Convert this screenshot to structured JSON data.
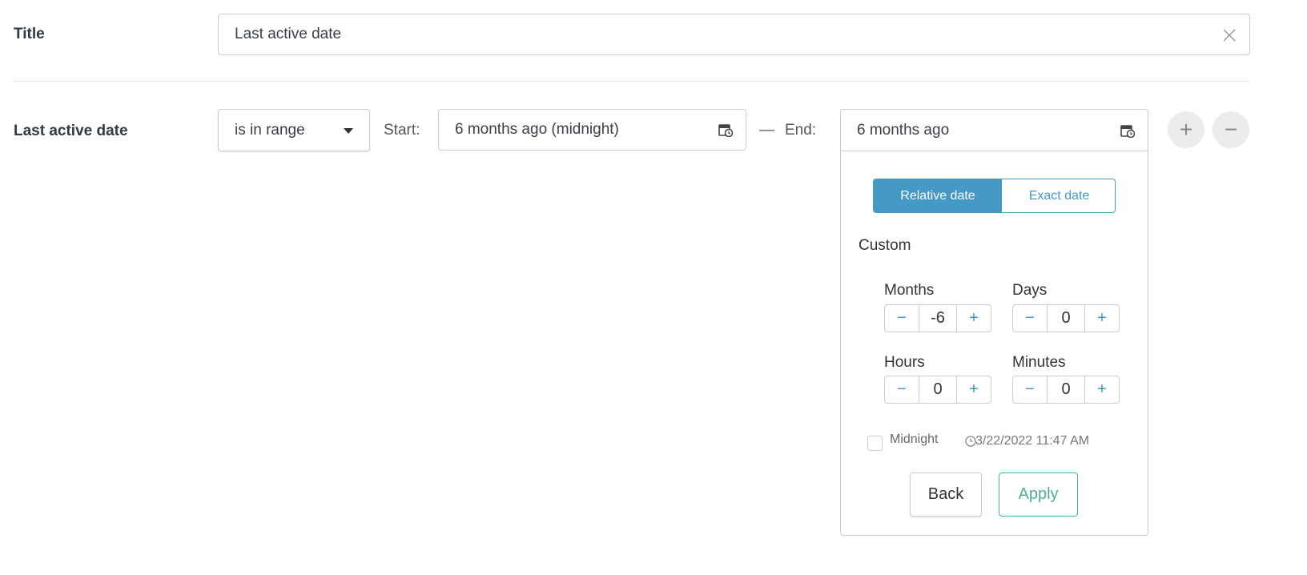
{
  "title_row": {
    "label": "Title",
    "value": "Last active date"
  },
  "filter_row": {
    "label": "Last active date",
    "operator": "is in range",
    "start_label": "Start:",
    "start_value": "6 months ago (midnight)",
    "separator": "—",
    "end_label": "End:",
    "end_value": "6 months ago"
  },
  "popover": {
    "tabs": [
      {
        "label": "Relative date",
        "active": true
      },
      {
        "label": "Exact date",
        "active": false
      }
    ],
    "section": "Custom",
    "steppers": [
      {
        "label": "Months",
        "value": "-6"
      },
      {
        "label": "Days",
        "value": "0"
      },
      {
        "label": "Hours",
        "value": "0"
      },
      {
        "label": "Minutes",
        "value": "0"
      }
    ],
    "decrement": "−",
    "increment": "+",
    "midnight_label": "Midnight",
    "midnight_checked": false,
    "resolved_date": "3/22/2022 11:47 AM",
    "back": "Back",
    "apply": "Apply"
  },
  "actions": {
    "add": "+",
    "remove": "−"
  },
  "colors": {
    "accent": "#4599c6",
    "apply": "#4caf8f"
  }
}
